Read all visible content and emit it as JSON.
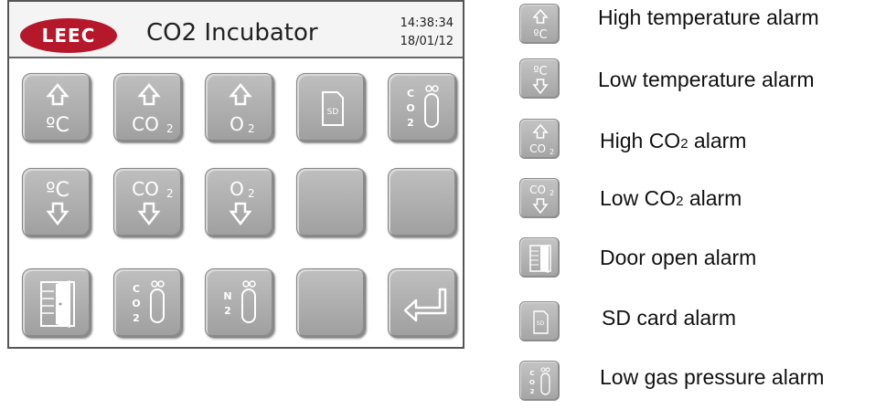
{
  "device": {
    "logo_text": "LEEC",
    "title": "CO2 Incubator",
    "time": "14:38:34",
    "date": "18/01/12",
    "tiles": [
      {
        "icon": "high-temperature-icon",
        "row": 0,
        "col": 0
      },
      {
        "icon": "high-co2-icon",
        "row": 0,
        "col": 1
      },
      {
        "icon": "high-o2-icon",
        "row": 0,
        "col": 2
      },
      {
        "icon": "sd-card-icon",
        "row": 0,
        "col": 3
      },
      {
        "icon": "co2-gas-cylinder-icon",
        "row": 0,
        "col": 4
      },
      {
        "icon": "low-temperature-icon",
        "row": 1,
        "col": 0
      },
      {
        "icon": "low-co2-icon",
        "row": 1,
        "col": 1
      },
      {
        "icon": "low-o2-icon",
        "row": 1,
        "col": 2
      },
      {
        "icon": "blank",
        "row": 1,
        "col": 3
      },
      {
        "icon": "blank",
        "row": 1,
        "col": 4
      },
      {
        "icon": "door-open-icon",
        "row": 2,
        "col": 0
      },
      {
        "icon": "co2-gas-cylinder-icon",
        "row": 2,
        "col": 1
      },
      {
        "icon": "n2-gas-cylinder-icon",
        "row": 2,
        "col": 2
      },
      {
        "icon": "blank",
        "row": 2,
        "col": 3
      },
      {
        "icon": "enter-return-icon",
        "row": 2,
        "col": 4
      }
    ]
  },
  "legend": [
    {
      "icon": "high-temperature-icon",
      "label": "High temperature alarm"
    },
    {
      "icon": "low-temperature-icon",
      "label": "Low temperature alarm"
    },
    {
      "icon": "high-co2-icon",
      "label_pre": "High CO",
      "label_sub": "2",
      "label_post": " alarm"
    },
    {
      "icon": "low-co2-icon",
      "label_pre": "Low CO",
      "label_sub": "2",
      "label_post": " alarm"
    },
    {
      "icon": "door-open-icon",
      "label": "Door open alarm"
    },
    {
      "icon": "sd-card-icon",
      "label": "SD card alarm"
    },
    {
      "icon": "co2-gas-cylinder-icon",
      "label": "Low gas pressure alarm"
    }
  ]
}
